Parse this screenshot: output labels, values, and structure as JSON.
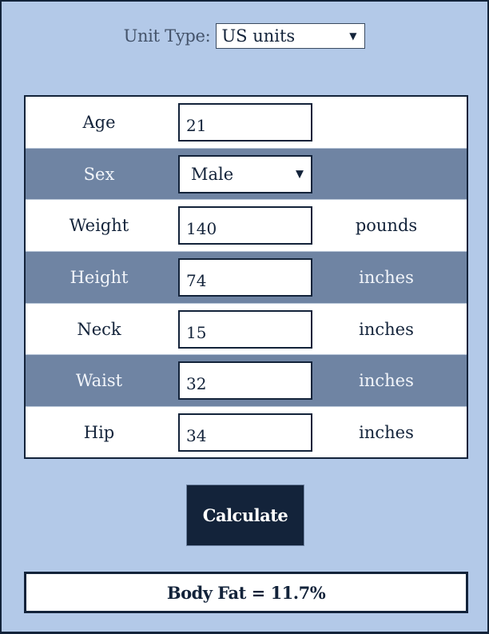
{
  "unit_type": {
    "label": "Unit Type:",
    "selected": "US units",
    "caret_icon": "▼"
  },
  "fields": [
    {
      "label": "Age",
      "value": "21",
      "unit": ""
    },
    {
      "label": "Sex",
      "value": "Male",
      "unit": "",
      "type": "select",
      "caret_icon": "▼"
    },
    {
      "label": "Weight",
      "value": "140",
      "unit": "pounds"
    },
    {
      "label": "Height",
      "value": "74",
      "unit": "inches"
    },
    {
      "label": "Neck",
      "value": "15",
      "unit": "inches"
    },
    {
      "label": "Waist",
      "value": "32",
      "unit": "inches"
    },
    {
      "label": "Hip",
      "value": "34",
      "unit": "inches"
    }
  ],
  "actions": {
    "calculate_label": "Calculate"
  },
  "result": {
    "text": "Body Fat = 11.7%"
  },
  "colors": {
    "background": "#b3c9e8",
    "dark": "#13233a",
    "alt_row": "#6f84a3"
  }
}
